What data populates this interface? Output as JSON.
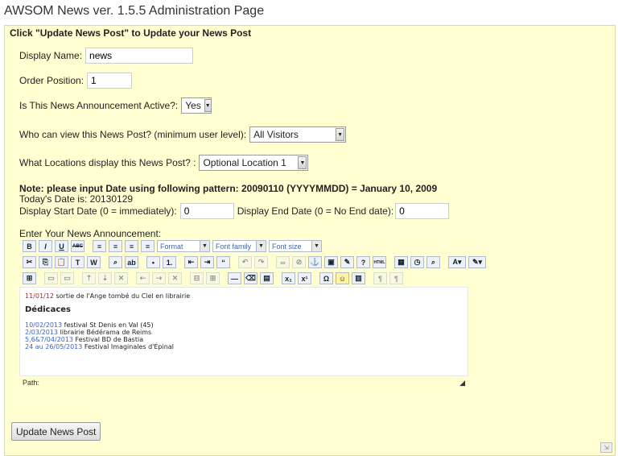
{
  "page": {
    "title": "AWSOM News ver. 1.5.5 Administration Page"
  },
  "form": {
    "header": "Click \"Update News Post\" to Update your News Post",
    "display_name": {
      "label": "Display Name:",
      "value": "news"
    },
    "order_position": {
      "label": "Order Position:",
      "value": "1"
    },
    "active": {
      "label": "Is This News Announcement Active?:",
      "value": "Yes"
    },
    "visibility": {
      "label": "Who can view this News Post? (minimum user level):",
      "value": "All Visitors"
    },
    "locations": {
      "label": "What Locations display this News Post? :",
      "value": "Optional Location 1"
    },
    "date_note": "Note: please input Date using following pattern: 20090110 (YYYYMMDD) = January 10, 2009",
    "today": "Today's Date is: 20130129",
    "start_date": {
      "label": "Display Start Date (0 = immediately):",
      "value": "0"
    },
    "end_date": {
      "label": "Display End Date (0 = No End date):",
      "value": "0"
    },
    "editor_label": "Enter Your News Announcement:",
    "submit_label": "Update News Post"
  },
  "editor": {
    "toolbar": {
      "bold": "B",
      "italic": "I",
      "underline": "U",
      "strike": "ABC",
      "format": "Format",
      "font_family": "Font family",
      "font_size": "Font size"
    },
    "content": {
      "line1_date": "11/01/12",
      "line1_text": " sortie de l'Ange tombé du Ciel en librairie",
      "heading": "Dédicaces",
      "events": [
        {
          "date": "10/02/2013",
          "text": " festival St Denis en Val (45)"
        },
        {
          "date": "2/03/2013",
          "text": " librairie Bédérama de Reims"
        },
        {
          "date": "5,6&7/04/2013",
          "text": " Festival BD de Bastia"
        },
        {
          "date": "24 au 26/05/2013",
          "text": " Festival Imaginales d'Épinal"
        }
      ]
    },
    "path_label": "Path:"
  }
}
